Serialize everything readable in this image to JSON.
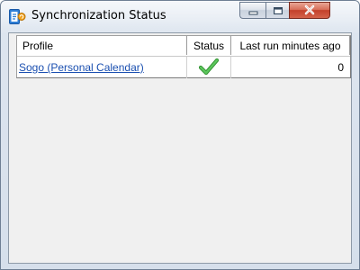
{
  "window": {
    "title": "Synchronization Status",
    "icon": "sync-app-icon",
    "controls": [
      "minimize-icon",
      "maximize-icon",
      "close-icon"
    ]
  },
  "table": {
    "columns": [
      "Profile",
      "Status",
      "Last run minutes ago"
    ],
    "rows": [
      {
        "profile": "Sogo (Personal Calendar)",
        "status": "check-icon",
        "status_color": "#3aa53a",
        "last_run": "0"
      }
    ]
  },
  "colors": {
    "link": "#1a4fb0",
    "close_button": "#c3402a",
    "client_bg": "#f0f0f0"
  }
}
